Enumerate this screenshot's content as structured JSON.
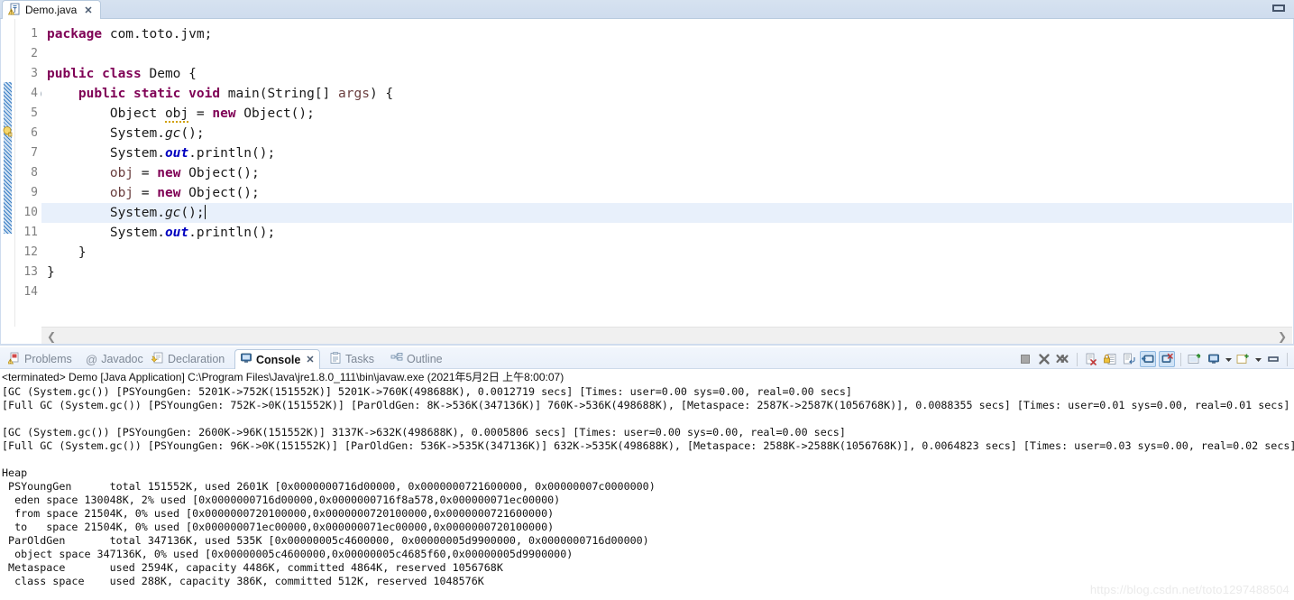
{
  "editor": {
    "tab": {
      "label": "Demo.java",
      "close": "✕",
      "icon": "java-file-warning-icon"
    },
    "minimize_label": "",
    "lines": [
      {
        "n": 1,
        "text": "package com.toto.jvm;"
      },
      {
        "n": 2,
        "text": ""
      },
      {
        "n": 3,
        "text": "public class Demo {"
      },
      {
        "n": 4,
        "text": "    public static void main(String[] args) {"
      },
      {
        "n": 5,
        "text": "        Object obj = new Object();"
      },
      {
        "n": 6,
        "text": "        System.gc();"
      },
      {
        "n": 7,
        "text": "        System.out.println();"
      },
      {
        "n": 8,
        "text": "        obj = new Object();"
      },
      {
        "n": 9,
        "text": "        obj = new Object();"
      },
      {
        "n": 10,
        "text": "        System.gc();"
      },
      {
        "n": 11,
        "text": "        System.out.println();"
      },
      {
        "n": 12,
        "text": "    }"
      },
      {
        "n": 13,
        "text": "}"
      },
      {
        "n": 14,
        "text": ""
      }
    ],
    "scroll_left_arrow": "❮",
    "scroll_right_arrow": "❯"
  },
  "console": {
    "tabs": [
      {
        "label": "Problems",
        "icon": "problems-icon",
        "active": false
      },
      {
        "label": "Javadoc",
        "icon": "javadoc-at-icon",
        "active": false
      },
      {
        "label": "Declaration",
        "icon": "declaration-icon",
        "active": false
      },
      {
        "label": "Console",
        "icon": "console-monitor-icon",
        "active": true,
        "close": "✕"
      },
      {
        "label": "Tasks",
        "icon": "tasks-icon",
        "active": false
      },
      {
        "label": "Outline",
        "icon": "outline-icon",
        "active": false
      }
    ],
    "toolbar": [
      {
        "name": "terminate-button",
        "glyph": "stop"
      },
      {
        "name": "remove-launch-button",
        "glyph": "x"
      },
      {
        "name": "remove-all-terminated-button",
        "glyph": "xx"
      },
      {
        "name": "clear-console-button",
        "glyph": "clear"
      },
      {
        "name": "scroll-lock-button",
        "glyph": "lock"
      },
      {
        "name": "word-wrap-button",
        "glyph": "wrap"
      },
      {
        "name": "show-console-when-stdout-button",
        "glyph": "stdout",
        "selected": true
      },
      {
        "name": "show-console-when-stderr-button",
        "glyph": "stderr",
        "selected": true
      },
      {
        "name": "pin-console-button",
        "glyph": "pin"
      },
      {
        "name": "display-selected-console-button",
        "glyph": "monitor"
      },
      {
        "name": "display-selected-console-menu",
        "glyph": "caret"
      },
      {
        "name": "open-console-button",
        "glyph": "newconsole"
      },
      {
        "name": "open-console-menu",
        "glyph": "caret"
      },
      {
        "name": "view-menu-button",
        "glyph": "menu"
      },
      {
        "name": "minimize-button",
        "glyph": "minimize"
      },
      {
        "name": "maximize-button",
        "glyph": "maximize"
      }
    ],
    "status_line": "<terminated> Demo [Java Application] C:\\Program Files\\Java\\jre1.8.0_111\\bin\\javaw.exe (2021年5月2日 上午8:00:07)",
    "output": [
      "[GC (System.gc()) [PSYoungGen: 5201K->752K(151552K)] 5201K->760K(498688K), 0.0012719 secs] [Times: user=0.00 sys=0.00, real=0.00 secs]",
      "[Full GC (System.gc()) [PSYoungGen: 752K->0K(151552K)] [ParOldGen: 8K->536K(347136K)] 760K->536K(498688K), [Metaspace: 2587K->2587K(1056768K)], 0.0088355 secs] [Times: user=0.01 sys=0.00, real=0.01 secs]",
      "",
      "[GC (System.gc()) [PSYoungGen: 2600K->96K(151552K)] 3137K->632K(498688K), 0.0005806 secs] [Times: user=0.00 sys=0.00, real=0.00 secs]",
      "[Full GC (System.gc()) [PSYoungGen: 96K->0K(151552K)] [ParOldGen: 536K->535K(347136K)] 632K->535K(498688K), [Metaspace: 2588K->2588K(1056768K)], 0.0064823 secs] [Times: user=0.03 sys=0.00, real=0.02 secs]",
      "",
      "Heap",
      " PSYoungGen      total 151552K, used 2601K [0x0000000716d00000, 0x0000000721600000, 0x00000007c0000000)",
      "  eden space 130048K, 2% used [0x0000000716d00000,0x0000000716f8a578,0x000000071ec00000)",
      "  from space 21504K, 0% used [0x0000000720100000,0x0000000720100000,0x0000000721600000)",
      "  to   space 21504K, 0% used [0x000000071ec00000,0x000000071ec00000,0x0000000720100000)",
      " ParOldGen       total 347136K, used 535K [0x00000005c4600000, 0x00000005d9900000, 0x0000000716d00000)",
      "  object space 347136K, 0% used [0x00000005c4600000,0x00000005c4685f60,0x00000005d9900000)",
      " Metaspace       used 2594K, capacity 4486K, committed 4864K, reserved 1056768K",
      "  class space    used 288K, capacity 386K, committed 512K, reserved 1048576K"
    ]
  },
  "watermark": "https://blog.csdn.net/toto1297488504",
  "colors": {
    "keyword": "#7f0055",
    "field": "#0000c0",
    "param": "#6a3e3e",
    "selection": "#e8f0fb",
    "tab_active": "#ffffff",
    "chrome": "#d6e2f0"
  }
}
